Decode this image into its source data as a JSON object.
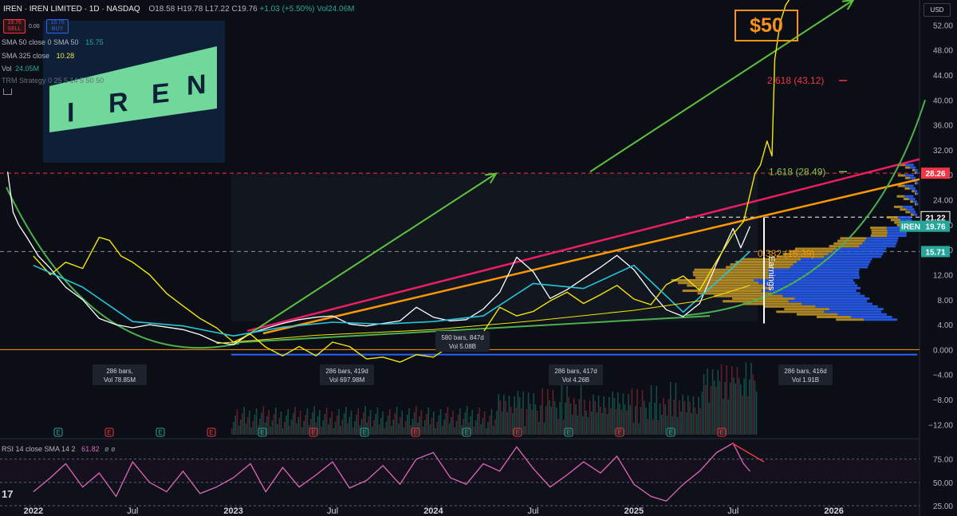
{
  "header": {
    "symbol": "IREN · IREN LIMITED · 1D · NASDAQ",
    "open": "O18.58",
    "high": "H19.78",
    "low": "L17.22",
    "close": "C19.76",
    "change": "+1.03 (+5.50%)",
    "volume": "Vol24.06M",
    "sell_price": "19.76",
    "sell_label": "SELL",
    "buy_price": "19.76",
    "buy_label": "BUY",
    "spread": "0.00",
    "currency": "USD"
  },
  "indicators": [
    {
      "label": "SMA 50 close 0 SMA 50",
      "value": "15.75",
      "color": "#26a69a"
    },
    {
      "label": "SMA 325 close",
      "value": "10.28",
      "color": "#f0e442"
    },
    {
      "label": "Vol",
      "value": "24.05M",
      "color": "#26a69a"
    },
    {
      "label": "TRM Strategy 0 25 5 14 5 50 50",
      "value": "",
      "color": "#6b6f78"
    }
  ],
  "logo_text": "IREN",
  "callout": "$50",
  "rsi_legend": "RSI 14 close SMA 14 2",
  "rsi_value": "61.82",
  "rsi_extra": "ø ø",
  "colors": {
    "price": "#ffffff",
    "sma50": "#26c6da",
    "sma325": "#f5e50a",
    "rsi": "#e066b8",
    "pink_line": "#e91e63",
    "orange_line": "#ff9800",
    "green": "#4caf50",
    "accent": "#f7931a"
  },
  "chart_data": {
    "type": "line",
    "ylim": [
      -14,
      56
    ],
    "y_ticks": [
      52,
      48,
      44,
      40,
      36,
      32,
      28,
      24,
      20,
      16,
      12,
      8,
      4,
      0,
      -4,
      -8,
      -12
    ],
    "y_tick_labels": [
      "52.00",
      "48.00",
      "44.00",
      "40.00",
      "36.00",
      "32.00",
      "28.00",
      "24.00",
      "20.00",
      "16.00",
      "12.00",
      "8.00",
      "4.00",
      "0.000",
      "−4.00",
      "−8.00",
      "−12.00"
    ],
    "x_labels": [
      "2022",
      "Jul",
      "2023",
      "Jul",
      "2024",
      "Jul",
      "2025",
      "Jul",
      "2026"
    ],
    "x_label_dates": [
      "2022-01",
      "2022-07",
      "2023-01",
      "2023-07",
      "2024-01",
      "2024-07",
      "2025-01",
      "2025-07",
      "2026-01"
    ],
    "x_range": [
      "2021-11",
      "2026-07"
    ],
    "price_labels": [
      {
        "text": "28.26",
        "value": 28.26,
        "color": "#f23645"
      },
      {
        "text": "21.22",
        "value": 21.22,
        "color": "#ffffff"
      },
      {
        "text": "IREN",
        "value": 19.76,
        "color": "#26a69a"
      },
      {
        "text": "19.76",
        "value": 19.76,
        "color": "#26a69a"
      },
      {
        "text": "15.71",
        "value": 15.71,
        "color": "#26a69a"
      }
    ],
    "series": [
      {
        "name": "IREN",
        "dates": [
          "2021-11-15",
          "2021-11-25",
          "2021-12-05",
          "2021-12-20",
          "2022-01-10",
          "2022-02-01",
          "2022-03-01",
          "2022-04-01",
          "2022-05-01",
          "2022-06-01",
          "2022-07-01",
          "2022-08-01",
          "2022-09-01",
          "2022-10-01",
          "2022-11-01",
          "2022-12-01",
          "2023-01-01",
          "2023-02-01",
          "2023-03-01",
          "2023-04-01",
          "2023-05-01",
          "2023-06-01",
          "2023-07-01",
          "2023-08-01",
          "2023-09-01",
          "2023-10-01",
          "2023-11-01",
          "2023-12-01",
          "2024-01-01",
          "2024-02-01",
          "2024-03-01",
          "2024-04-01",
          "2024-05-01",
          "2024-06-01",
          "2024-07-01",
          "2024-08-01",
          "2024-09-01",
          "2024-10-01",
          "2024-11-01",
          "2024-12-01",
          "2025-01-01",
          "2025-02-01",
          "2025-03-01",
          "2025-04-01",
          "2025-05-01",
          "2025-06-01",
          "2025-07-01",
          "2025-07-15",
          "2025-08-01"
        ],
        "values": [
          28.5,
          22,
          20,
          18,
          15,
          13,
          10,
          8,
          5,
          4,
          3.5,
          4,
          3.6,
          3.2,
          2.4,
          1.2,
          0.8,
          2.6,
          3.4,
          4.2,
          4.8,
          5.2,
          5.4,
          4.1,
          3.8,
          4.2,
          4.6,
          6.8,
          5.2,
          4.6,
          4.8,
          6.5,
          9.2,
          14.8,
          12.5,
          8.2,
          9.6,
          11.4,
          13.2,
          15.1,
          12.8,
          9.2,
          6.4,
          5.3,
          7.4,
          13.8,
          19.4,
          16.3,
          19.76
        ]
      },
      {
        "name": "IREN (overlay)",
        "dates": [
          "2022-01-01",
          "2022-02-01",
          "2022-03-01",
          "2022-04-01",
          "2022-05-01",
          "2022-05-20",
          "2022-06-10",
          "2022-07-01",
          "2022-08-01",
          "2022-09-01",
          "2022-10-01",
          "2022-11-01",
          "2022-12-01",
          "2023-01-01",
          "2023-02-01",
          "2023-03-01",
          "2023-04-01",
          "2023-05-01",
          "2023-06-01",
          "2023-07-01",
          "2023-08-01",
          "2023-09-01",
          "2023-10-01",
          "2023-11-01",
          "2023-12-01",
          "2024-01-01",
          "2024-02-01",
          "2024-03-01",
          "2024-04-01",
          "2024-05-01",
          "2024-06-01",
          "2024-07-01",
          "2024-08-01",
          "2024-09-01",
          "2024-10-01",
          "2024-11-01",
          "2024-12-01",
          "2025-01-01",
          "2025-02-01",
          "2025-03-01",
          "2025-04-01",
          "2025-05-01",
          "2025-06-01",
          "2025-07-01",
          "2025-07-20",
          "2025-08-10",
          "2025-08-20",
          "2025-09-01",
          "2025-09-10",
          "2025-09-15",
          "2025-09-25",
          "2025-10-05",
          "2025-10-12"
        ],
        "values": [
          15,
          12,
          14,
          13,
          18,
          17.5,
          15,
          14,
          12,
          9,
          7,
          5,
          3.5,
          1.2,
          2.5,
          0.4,
          -1,
          0.5,
          -1,
          1.2,
          0.5,
          -1.5,
          -1.2,
          -2,
          -0.8,
          -1.2,
          0.6,
          0.1,
          2.8,
          6.8,
          5.4,
          6.1,
          7.8,
          9.2,
          7.4,
          8.8,
          10.3,
          8.1,
          7.2,
          10.4,
          11.8,
          9.5,
          14.2,
          18.5,
          20.5,
          28.2,
          29.6,
          33.4,
          31.0,
          46.5,
          52.4,
          55.2,
          56.1
        ]
      },
      {
        "name": "SMA 50",
        "dates": [
          "2022-01-01",
          "2022-04-01",
          "2022-07-01",
          "2022-10-01",
          "2023-01-01",
          "2023-04-01",
          "2023-07-01",
          "2023-10-01",
          "2024-01-01",
          "2024-04-01",
          "2024-07-01",
          "2024-10-01",
          "2025-01-01",
          "2025-04-01",
          "2025-07-01",
          "2025-08-01"
        ],
        "values": [
          13.5,
          10,
          4.5,
          3.8,
          2.2,
          3.6,
          4.4,
          4.1,
          4.5,
          5.4,
          10.6,
          9.8,
          13.5,
          6.0,
          13.2,
          15.75
        ]
      },
      {
        "name": "SMA 325",
        "dates": [
          "2022-12-01",
          "2023-06-01",
          "2024-01-01",
          "2024-07-01",
          "2025-01-01",
          "2025-05-01",
          "2025-08-01"
        ],
        "values": [
          1.0,
          2.3,
          3.2,
          4.6,
          6.3,
          7.8,
          10.28
        ]
      }
    ],
    "annotations": [
      {
        "text": "2.618 (43.12)",
        "value": 43.12,
        "color": "#f23645"
      },
      {
        "text": "1.618 (28.49)",
        "value": 28.49,
        "color": "#8bc34a"
      },
      {
        "text": "0.382 (15.39)",
        "value": 15.39,
        "color": "#ff9800"
      },
      {
        "text": "Earnings",
        "color": "#ffffff"
      }
    ],
    "range_labels": [
      {
        "lines": [
          "286 bars,",
          "Vol 78.85M"
        ]
      },
      {
        "lines": [
          "286 bars, 419d",
          "Vol 697.98M"
        ]
      },
      {
        "lines": [
          "580 bars, 847d",
          "Vol 5.08B"
        ]
      },
      {
        "lines": [
          "286 bars, 417d",
          "Vol 4.26B"
        ]
      },
      {
        "lines": [
          "286 bars, 416d",
          "Vol 1.91B"
        ]
      }
    ],
    "rsi": {
      "ylim": [
        20,
        90
      ],
      "y_ticks": [
        75,
        50,
        25
      ],
      "y_tick_labels": [
        "75.00",
        "50.00",
        "25.00"
      ],
      "dates": [
        "2022-01-01",
        "2022-02-01",
        "2022-03-01",
        "2022-04-01",
        "2022-05-01",
        "2022-06-01",
        "2022-07-01",
        "2022-08-01",
        "2022-09-01",
        "2022-10-01",
        "2022-11-01",
        "2022-12-01",
        "2023-01-01",
        "2023-02-01",
        "2023-03-01",
        "2023-04-01",
        "2023-05-01",
        "2023-06-01",
        "2023-07-01",
        "2023-08-01",
        "2023-09-01",
        "2023-10-01",
        "2023-11-01",
        "2023-12-01",
        "2024-01-01",
        "2024-02-01",
        "2024-03-01",
        "2024-04-01",
        "2024-05-01",
        "2024-06-01",
        "2024-07-01",
        "2024-08-01",
        "2024-09-01",
        "2024-10-01",
        "2024-11-01",
        "2024-12-01",
        "2025-01-01",
        "2025-02-01",
        "2025-03-01",
        "2025-04-01",
        "2025-05-01",
        "2025-06-01",
        "2025-07-01",
        "2025-07-20",
        "2025-08-01"
      ],
      "values": [
        40,
        55,
        70,
        45,
        60,
        35,
        72,
        50,
        40,
        62,
        38,
        45,
        55,
        70,
        40,
        66,
        45,
        58,
        72,
        44,
        52,
        68,
        48,
        75,
        82,
        55,
        48,
        70,
        62,
        88,
        65,
        45,
        58,
        72,
        60,
        78,
        48,
        35,
        30,
        48,
        62,
        82,
        92,
        70,
        61.82
      ]
    },
    "volume_labels": [
      "E",
      "E",
      "E",
      "E",
      "E",
      "E",
      "E",
      "E",
      "E",
      "E",
      "E",
      "E",
      "E",
      "E"
    ]
  }
}
